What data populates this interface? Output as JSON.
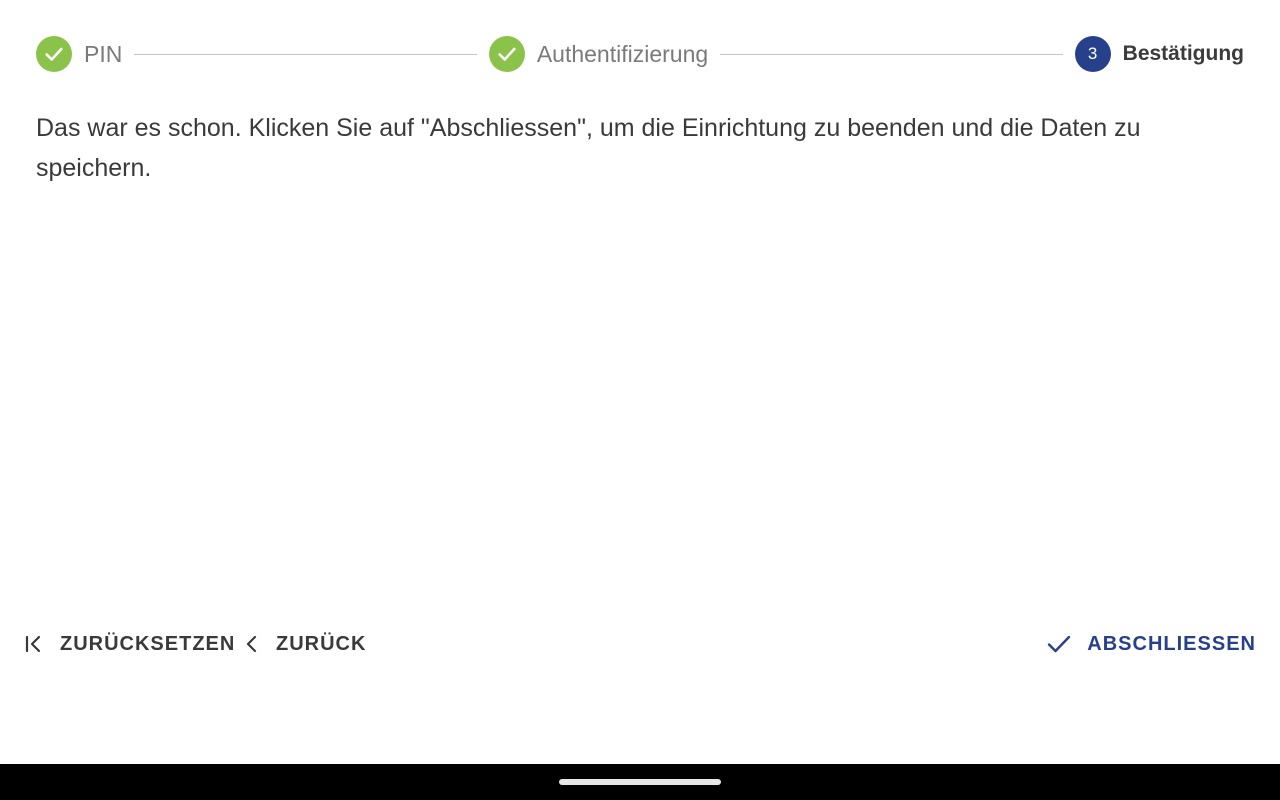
{
  "stepper": {
    "steps": [
      {
        "label": "PIN",
        "status": "done",
        "icon": "check-icon"
      },
      {
        "label": "Authentifizierung",
        "status": "done",
        "icon": "check-icon"
      },
      {
        "label": "Bestätigung",
        "status": "active",
        "number": "3"
      }
    ]
  },
  "content": {
    "message": "Das war es schon. Klicken Sie auf \"Abschliessen\", um die Einrichtung zu beenden und die Daten zu speichern."
  },
  "actions": {
    "reset": {
      "label": "ZURÜCKSETZEN",
      "icon": "skip-to-start-icon"
    },
    "back": {
      "label": "ZURÜCK",
      "icon": "chevron-left-icon"
    },
    "finish": {
      "label": "ABSCHLIESSEN",
      "icon": "check-icon"
    }
  },
  "colors": {
    "done": "#8bc34a",
    "active": "#27408b",
    "text": "#3a3a3a",
    "muted": "#7a7a7a",
    "divider": "#c4c4c4"
  }
}
